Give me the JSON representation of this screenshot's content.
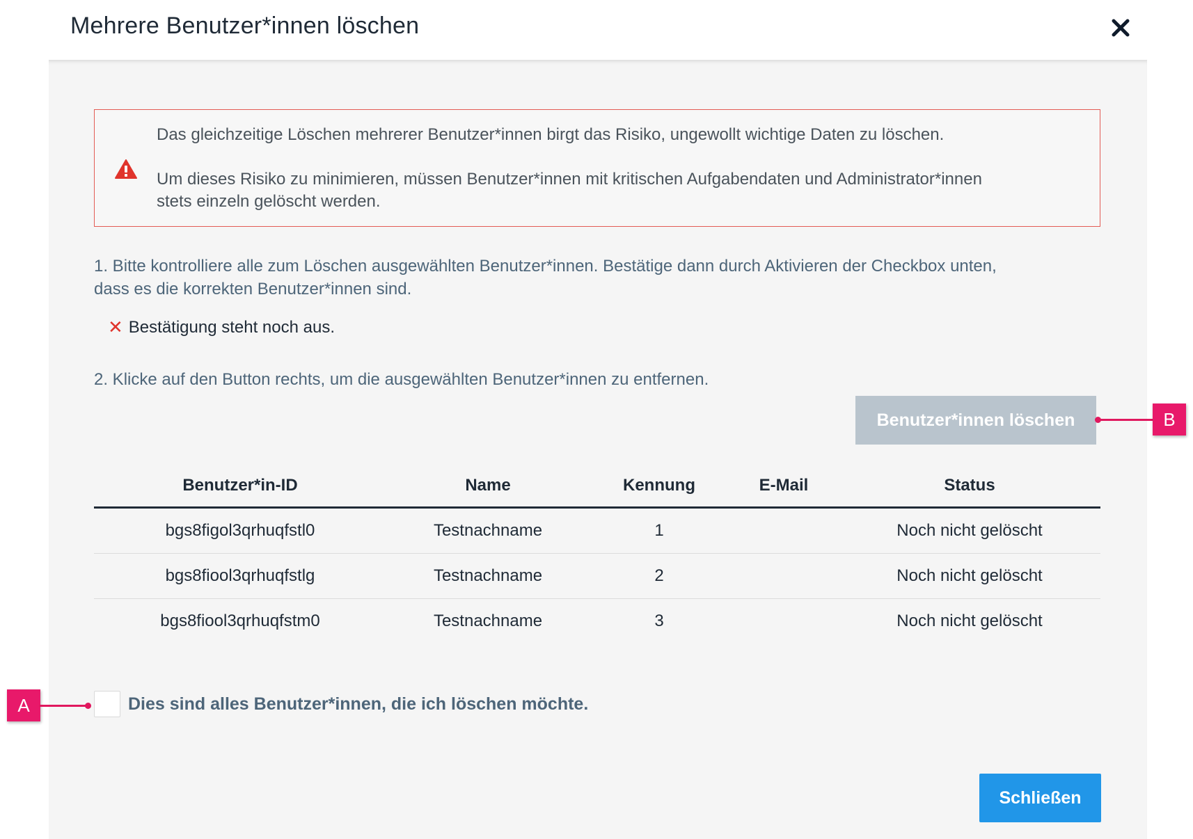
{
  "dialog": {
    "title": "Mehrere Benutzer*innen löschen",
    "close_icon": "close-icon"
  },
  "warning": {
    "icon": "warning-triangle-icon",
    "line1": "Das gleichzeitige Löschen mehrerer Benutzer*innen birgt das Risiko, ungewollt wichtige Daten zu löschen.",
    "line2a": "Um dieses Risiko zu minimieren, müssen Benutzer*innen mit kritischen Aufgabendaten und Administrator*innen",
    "line2b": "stets einzeln gelöscht werden.",
    "border_color": "#e35b54"
  },
  "step1": {
    "line_a": "1. Bitte kontrolliere alle zum Löschen ausgewählten Benutzer*innen. Bestätige dann durch Aktivieren der Checkbox unten,",
    "line_b": "dass es die korrekten Benutzer*innen sind.",
    "pending_icon": "x-mark-icon",
    "pending_text": "Bestätigung steht noch aus."
  },
  "step2": {
    "text": "2. Klicke auf den Button rechts, um die ausgewählten Benutzer*innen zu entfernen.",
    "delete_button_label": "Benutzer*innen löschen",
    "delete_button_enabled": false
  },
  "table": {
    "headers": [
      "Benutzer*in-ID",
      "Name",
      "Kennung",
      "E-Mail",
      "Status"
    ],
    "rows": [
      {
        "id": "bgs8figol3qrhuqfstl0",
        "name": "Testnachname",
        "kennung": "1",
        "email": "",
        "status": "Noch nicht gelöscht"
      },
      {
        "id": "bgs8fiool3qrhuqfstlg",
        "name": "Testnachname",
        "kennung": "2",
        "email": "",
        "status": "Noch nicht gelöscht"
      },
      {
        "id": "bgs8fiool3qrhuqfstm0",
        "name": "Testnachname",
        "kennung": "3",
        "email": "",
        "status": "Noch nicht gelöscht"
      }
    ]
  },
  "confirm": {
    "checked": false,
    "label": "Dies sind alles Benutzer*innen, die ich löschen möchte."
  },
  "footer": {
    "close_button_label": "Schließen"
  },
  "callouts": {
    "a": "A",
    "b": "B",
    "color": "#e8196a"
  },
  "colors": {
    "primary": "#2196e8",
    "disabled": "#b9c4cd",
    "status_link": "#2f96d8",
    "danger": "#e0342c"
  }
}
